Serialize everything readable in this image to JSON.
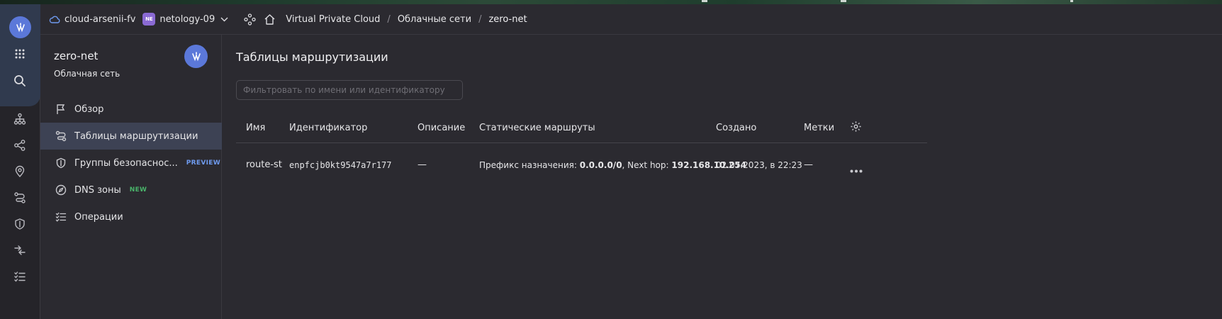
{
  "topbar": {
    "cloud_name": "cloud-arsenii-fv",
    "folder_badge": "NE",
    "folder_name": "netology-09",
    "breadcrumbs": [
      "Virtual Private Cloud",
      "Облачные сети",
      "zero-net"
    ],
    "separator": "/"
  },
  "sidebar": {
    "title": "zero-net",
    "subtitle": "Облачная сеть",
    "items": [
      {
        "label": "Обзор",
        "icon": "flag-icon",
        "tag": ""
      },
      {
        "label": "Таблицы маршрутизации",
        "icon": "route-icon",
        "tag": "",
        "active": true
      },
      {
        "label": "Группы безопаснос...",
        "icon": "shield-icon",
        "tag": "PREVIEW"
      },
      {
        "label": "DNS зоны",
        "icon": "dns-icon",
        "tag": "NEW"
      },
      {
        "label": "Операции",
        "icon": "operations-icon",
        "tag": ""
      }
    ]
  },
  "main": {
    "title": "Таблицы маршрутизации",
    "filter_placeholder": "Фильтровать по имени или идентификатору",
    "columns": [
      "Имя",
      "Идентификатор",
      "Описание",
      "Статические маршруты",
      "Создано",
      "Метки"
    ],
    "rows": [
      {
        "name": "route-st",
        "id": "enpfcjb0kt9547a7r177",
        "description": "—",
        "route_prefix_label": "Префикс назначения:",
        "route_prefix": "0.0.0.0/0",
        "route_hop_label": ", Next hop:",
        "route_hop": "192.168.10.254",
        "created": "02.07.2023, в 22:23",
        "labels": "—"
      }
    ]
  },
  "colors": {
    "background": "#2b2a30",
    "rail": "#252429",
    "accent": "#5b78d9",
    "active_item": "#3d4254",
    "preview": "#6f9bf0",
    "new": "#49b36a"
  }
}
